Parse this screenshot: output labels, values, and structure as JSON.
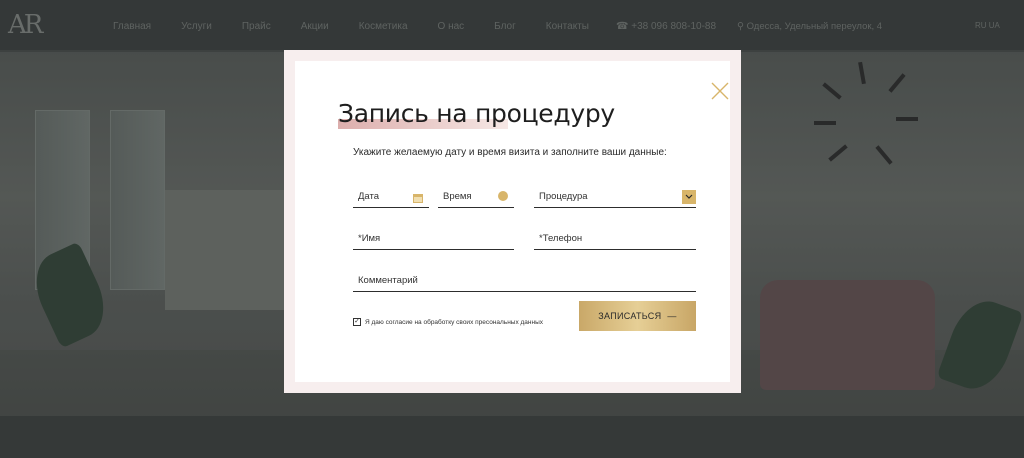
{
  "nav": {
    "logo": "AR",
    "menu": [
      "Главная",
      "Услуги",
      "Прайс",
      "Акции",
      "Косметика",
      "О нас",
      "Блог",
      "Контакты"
    ],
    "phone": "+38 096 808-10-88",
    "address": "Одесса, Удельный переулок, 4",
    "lang": "RU UA"
  },
  "modal": {
    "title": "Запись на процедуру",
    "subtitle": "Укажите желаемую дату и время визита и заполните ваши данные:",
    "fields": {
      "date": "Дата",
      "time": "Время",
      "procedure": "Процедура",
      "name": "*Имя",
      "phone": "*Телефон",
      "comment": "Комментарий"
    },
    "consent": "Я даю согласие на обработку своих пресональных данных",
    "consent_checked": true,
    "submit": "ЗАПИСАТЬСЯ",
    "submit_arrow": "—"
  },
  "colors": {
    "accent_gold": "#d8b56a",
    "highlight_pink": "#d6a09e",
    "modal_frame": "#f7eeee"
  },
  "icons": [
    "close-icon",
    "calendar-icon",
    "clock-icon",
    "chevron-down-icon",
    "phone-icon",
    "location-icon",
    "checkbox-checked-icon"
  ]
}
